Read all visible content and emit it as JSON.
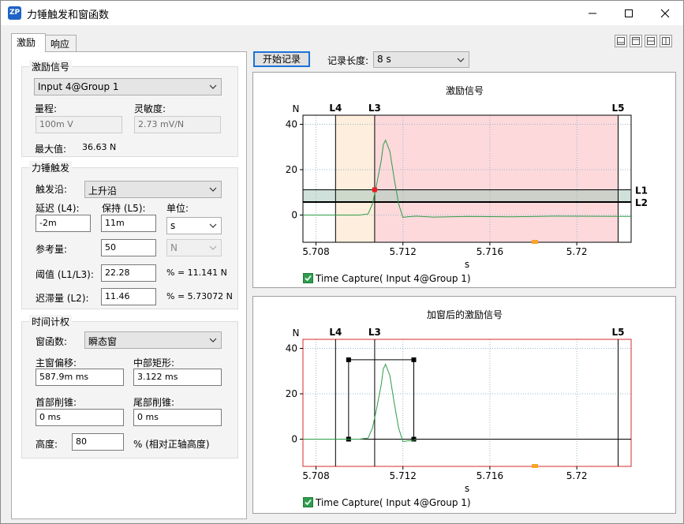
{
  "window": {
    "title": "力锤触发和窗函数",
    "app_icon_text": "ZP"
  },
  "tabs": [
    {
      "label": "激励",
      "active": true
    },
    {
      "label": "响应",
      "active": false
    }
  ],
  "excitation": {
    "group_title": "激励信号",
    "channel": "Input 4@Group 1",
    "range_label": "量程:",
    "range_value": "100m V",
    "sensitivity_label": "灵敏度:",
    "sensitivity_value": "2.73 mV/N",
    "max_label": "最大值:",
    "max_value": "36.63 N"
  },
  "trigger": {
    "group_title": "力锤触发",
    "edge_label": "触发沿:",
    "edge_value": "上升沿",
    "delay_label": "延迟 (L4):",
    "delay_value": "-2m",
    "hold_label": "保持 (L5):",
    "hold_value": "11m",
    "unit_label": "单位:",
    "unit_value": "s",
    "ref_label": "参考量:",
    "ref_value": "50",
    "ref_unit": "N",
    "threshold_label": "阈值 (L1/L3):",
    "threshold_value": "22.28",
    "threshold_pct": "% = 11.141 N",
    "hysteresis_label": "迟滞量 (L2):",
    "hysteresis_value": "11.46",
    "hysteresis_pct": "% = 5.73072 N"
  },
  "window_fn": {
    "group_title": "时间计权",
    "func_label": "窗函数:",
    "func_value": "瞬态窗",
    "offset_label": "主窗偏移:",
    "offset_value": "587.9m ms",
    "rect_label": "中部矩形:",
    "rect_value": "3.122 ms",
    "head_label": "首部削锥:",
    "head_value": "0 ms",
    "tail_label": "尾部削锥:",
    "tail_value": "0 ms",
    "height_label": "高度:",
    "height_value": "80",
    "height_note": "% (相对正轴高度)"
  },
  "toolbar": {
    "start_label": "开始记录",
    "record_length_label": "记录长度:",
    "record_length_value": "8 s"
  },
  "colors": {
    "accent": "#1a73d6",
    "signal": "#2e9b48",
    "pre_region": "#fdeedd",
    "hold_region": "#fdd9dc",
    "hyst_band": "#a8c8bc",
    "window_frame": "#d62b2b",
    "marker": "#ee1c1c",
    "orange_marker": "#f7a52b"
  },
  "charts": {
    "top": {
      "title": "激励信号",
      "y_unit": "N",
      "x_unit": "s",
      "legend": "Time Capture( Input 4@Group 1)",
      "lines": {
        "L1": "L1",
        "L2": "L2",
        "L3": "L3",
        "L4": "L4",
        "L5": "L5"
      }
    },
    "bottom": {
      "title": "加窗后的激励信号",
      "y_unit": "N",
      "x_unit": "s",
      "legend": "Time Capture( Input 4@Group 1)",
      "lines": {
        "L3": "L3",
        "L4": "L4",
        "L5": "L5"
      }
    }
  },
  "chart_data": [
    {
      "type": "line",
      "title": "激励信号",
      "ylabel": "N",
      "xlabel": "s",
      "xlim": [
        5.7074,
        5.7225
      ],
      "ylim": [
        -12,
        44
      ],
      "x_ticks": [
        "5.708",
        "5.712",
        "5.716",
        "5.72"
      ],
      "y_ticks": [
        "0",
        "20",
        "40"
      ],
      "grid": true,
      "markers": {
        "L4": 5.7089,
        "L3": 5.7107,
        "L5": 5.7219,
        "L1": 11.141,
        "L2": 5.73
      },
      "series": [
        {
          "name": "Time Capture( Input 4@Group 1)",
          "x": [
            5.7074,
            5.71,
            5.7104,
            5.7106,
            5.7108,
            5.711,
            5.7111,
            5.7112,
            5.7114,
            5.7116,
            5.7118,
            5.712,
            5.7122,
            5.7126,
            5.7134,
            5.715,
            5.717,
            5.719,
            5.7225
          ],
          "y": [
            0,
            0,
            0.5,
            5,
            14,
            24,
            31,
            33,
            28,
            16,
            5,
            -1,
            -0.8,
            -0.5,
            -0.9,
            -0.6,
            -0.8,
            -0.5,
            -0.6
          ]
        }
      ]
    },
    {
      "type": "line",
      "title": "加窗后的激励信号",
      "ylabel": "N",
      "xlabel": "s",
      "xlim": [
        5.7074,
        5.7225
      ],
      "ylim": [
        -12,
        44
      ],
      "x_ticks": [
        "5.708",
        "5.712",
        "5.716",
        "5.72"
      ],
      "y_ticks": [
        "0",
        "20",
        "40"
      ],
      "grid": true,
      "markers": {
        "L4": 5.7089,
        "L3": 5.7107,
        "L5": 5.7219
      },
      "series": [
        {
          "name": "Time Capture( Input 4@Group 1)",
          "x": [
            5.7074,
            5.71,
            5.7104,
            5.7106,
            5.7108,
            5.711,
            5.7111,
            5.7112,
            5.7114,
            5.7116,
            5.7118,
            5.712,
            5.7122,
            5.7125,
            5.7126
          ],
          "y": [
            0,
            0,
            0.5,
            5,
            14,
            24,
            31,
            33,
            28,
            16,
            5,
            -1,
            -0.8,
            -0.5,
            0
          ]
        }
      ],
      "window": {
        "start": 5.7095,
        "end": 5.7125,
        "height": 35
      }
    }
  ]
}
